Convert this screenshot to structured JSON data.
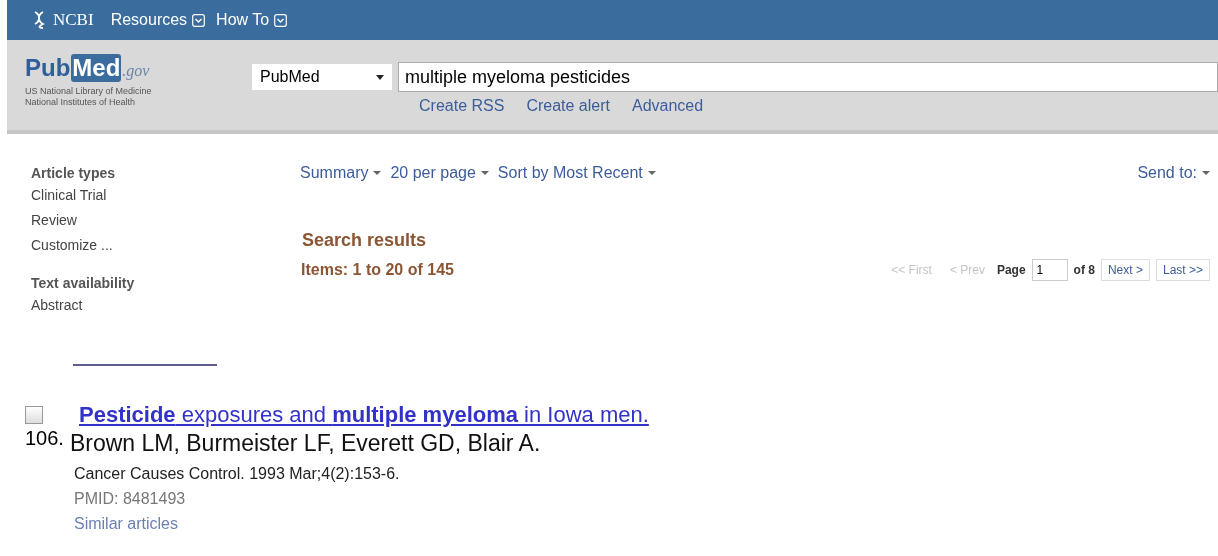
{
  "ncbi_bar": {
    "brand": "NCBI",
    "menus": [
      {
        "label": "Resources"
      },
      {
        "label": "How To"
      }
    ]
  },
  "header": {
    "logo": [
      "Pub",
      "Med",
      ".gov"
    ],
    "org_lines": [
      "US National Library of Medicine",
      "National Institutes of Health"
    ],
    "database": "PubMed",
    "search": {
      "value": "multiple myeloma pesticides"
    },
    "links": [
      "Create RSS",
      "Create alert",
      "Advanced"
    ]
  },
  "filters": [
    {
      "heading": "Article types",
      "items": [
        "Clinical Trial",
        "Review",
        "Customize ..."
      ]
    },
    {
      "heading": "Text availability",
      "items": [
        "Abstract"
      ]
    }
  ],
  "display": {
    "options": [
      "Summary",
      "20 per page",
      "Sort by Most Recent"
    ],
    "send_to": "Send to:"
  },
  "results": {
    "title": "Search results",
    "count": "Items: 1 to 20 of 145"
  },
  "pager": {
    "first": {
      "label": "<< First",
      "disabled": true
    },
    "prev": {
      "label": "< Prev",
      "disabled": true
    },
    "page_label": "Page",
    "page": "1",
    "of": "of 8",
    "next": {
      "label": "Next >",
      "disabled": false
    },
    "last": {
      "label": "Last >>",
      "disabled": false
    }
  },
  "result": {
    "checked": false,
    "number": "106.",
    "title": "**Pesticide** exposures and **multiple myeloma** in Iowa men.",
    "authors": "Brown LM, Burmeister LF, Everett GD, Blair A.",
    "citation": "Cancer Causes Control. 1993 Mar;4(2):153-6.",
    "pmid": "PMID: 8481493",
    "similar": "Similar articles"
  }
}
